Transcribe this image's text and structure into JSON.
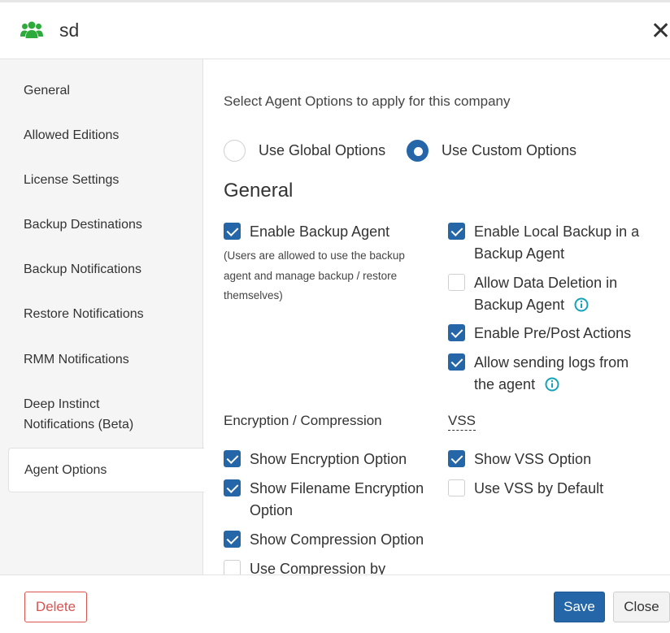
{
  "header": {
    "title": "sd",
    "icon": "users-group-icon",
    "icon_color": "#2eaa3c"
  },
  "sidebar": {
    "items": [
      {
        "label": "General"
      },
      {
        "label": "Allowed Editions"
      },
      {
        "label": "License Settings"
      },
      {
        "label": "Backup Destinations"
      },
      {
        "label": "Backup Notifications"
      },
      {
        "label": "Restore Notifications"
      },
      {
        "label": "RMM Notifications"
      },
      {
        "label": "Deep Instinct"
      },
      {
        "label": "Notifications (Beta)"
      },
      {
        "label": "Agent Options",
        "active": true
      }
    ]
  },
  "content": {
    "intro": "Select Agent Options to apply for this company",
    "options": [
      {
        "label": "Use Global Options",
        "selected": false
      },
      {
        "label": "Use Custom Options",
        "selected": true
      }
    ],
    "section_general": "General",
    "general_left": {
      "enable_backup_agent": {
        "label": "Enable Backup Agent",
        "checked": true
      },
      "note": "(Users are allowed to use the backup agent and manage backup / restore themselves)"
    },
    "general_right": [
      {
        "label": "Enable Local Backup in a Backup Agent",
        "checked": true,
        "info": false
      },
      {
        "label": "Allow Data Deletion in Backup Agent",
        "checked": false,
        "info": true
      },
      {
        "label": "Enable Pre/Post Actions",
        "checked": true,
        "info": false
      },
      {
        "label": "Allow sending logs from the agent",
        "checked": true,
        "info": true
      }
    ],
    "encryption_title": "Encryption / Compression",
    "encryption": [
      {
        "label": "Show Encryption Option",
        "checked": true
      },
      {
        "label": "Show Filename Encryption Option",
        "checked": true
      },
      {
        "label": "Show Compression Option",
        "checked": true
      },
      {
        "label": "Use Compression by",
        "checked": false
      }
    ],
    "vss_title": "VSS",
    "vss": [
      {
        "label": "Show VSS Option",
        "checked": true
      },
      {
        "label": "Use VSS by Default",
        "checked": false
      }
    ]
  },
  "footer": {
    "delete_label": "Delete",
    "save_label": "Save",
    "close_label": "Close"
  },
  "colors": {
    "accent": "#2466a8",
    "danger": "#d9534f",
    "info": "#17a2b8"
  }
}
